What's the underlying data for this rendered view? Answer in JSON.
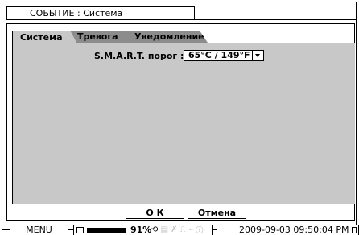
{
  "window": {
    "title": "СОБЫТИЕ : Система"
  },
  "tabs": [
    {
      "label": "Система"
    },
    {
      "label": "Тревога"
    },
    {
      "label": "Уведомление"
    }
  ],
  "smart": {
    "label": "S.M.A.R.T.  порог :",
    "value": "65°C / 149°F"
  },
  "buttons": {
    "ok": "О К",
    "cancel": "Отмена"
  },
  "status": {
    "menu": "MENU",
    "percent": "91%",
    "icons_active": "⟲",
    "icons_inactive": "▤ ✗ ⎍ ⌁ ⓘ",
    "clock": "2009-09-03 09:50:04 PM"
  }
}
